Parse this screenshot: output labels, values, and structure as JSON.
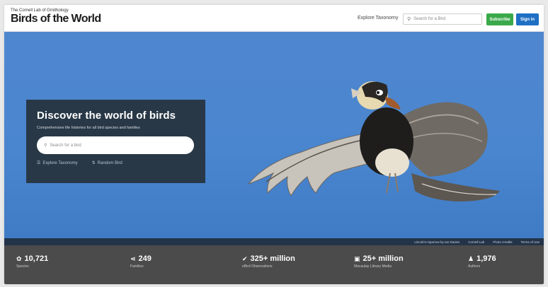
{
  "header": {
    "brand_small": "The Cornell Lab of Ornithology",
    "brand_title": "Birds of the World",
    "nav_link": "Explore Taxonomy",
    "search_placeholder": "Search for a Bird",
    "subscribe_label": "Subscribe",
    "signin_label": "Sign in"
  },
  "hero": {
    "title": "Discover the world of birds",
    "subtitle": "Comprehensive life histories for all bird species and families",
    "search_placeholder": "Search for a bird",
    "link_taxonomy": "Explore Taxonomy",
    "link_random": "Random Bird",
    "credits": [
      "Lincoln's Sparrow by Ian Davies",
      "Cornell Lab",
      "Photo Credits",
      "Terms of Use"
    ]
  },
  "stats": [
    {
      "value": "10,721",
      "label": "Species",
      "icon": "bird-icon"
    },
    {
      "value": "249",
      "label": "Families",
      "icon": "branch-icon"
    },
    {
      "value": "325+ million",
      "label": "eBird Observations",
      "icon": "check-circle-icon"
    },
    {
      "value": "25+ million",
      "label": "Macaulay Library Media",
      "icon": "media-icon"
    },
    {
      "value": "1,976",
      "label": "Authors",
      "icon": "person-icon"
    }
  ],
  "colors": {
    "hero_blue": "#4a86cf",
    "subscribe_green": "#3aa94a",
    "signin_blue": "#1f6fc4",
    "panel_dark": "#26323c",
    "stats_bar": "#4b4b4b"
  }
}
